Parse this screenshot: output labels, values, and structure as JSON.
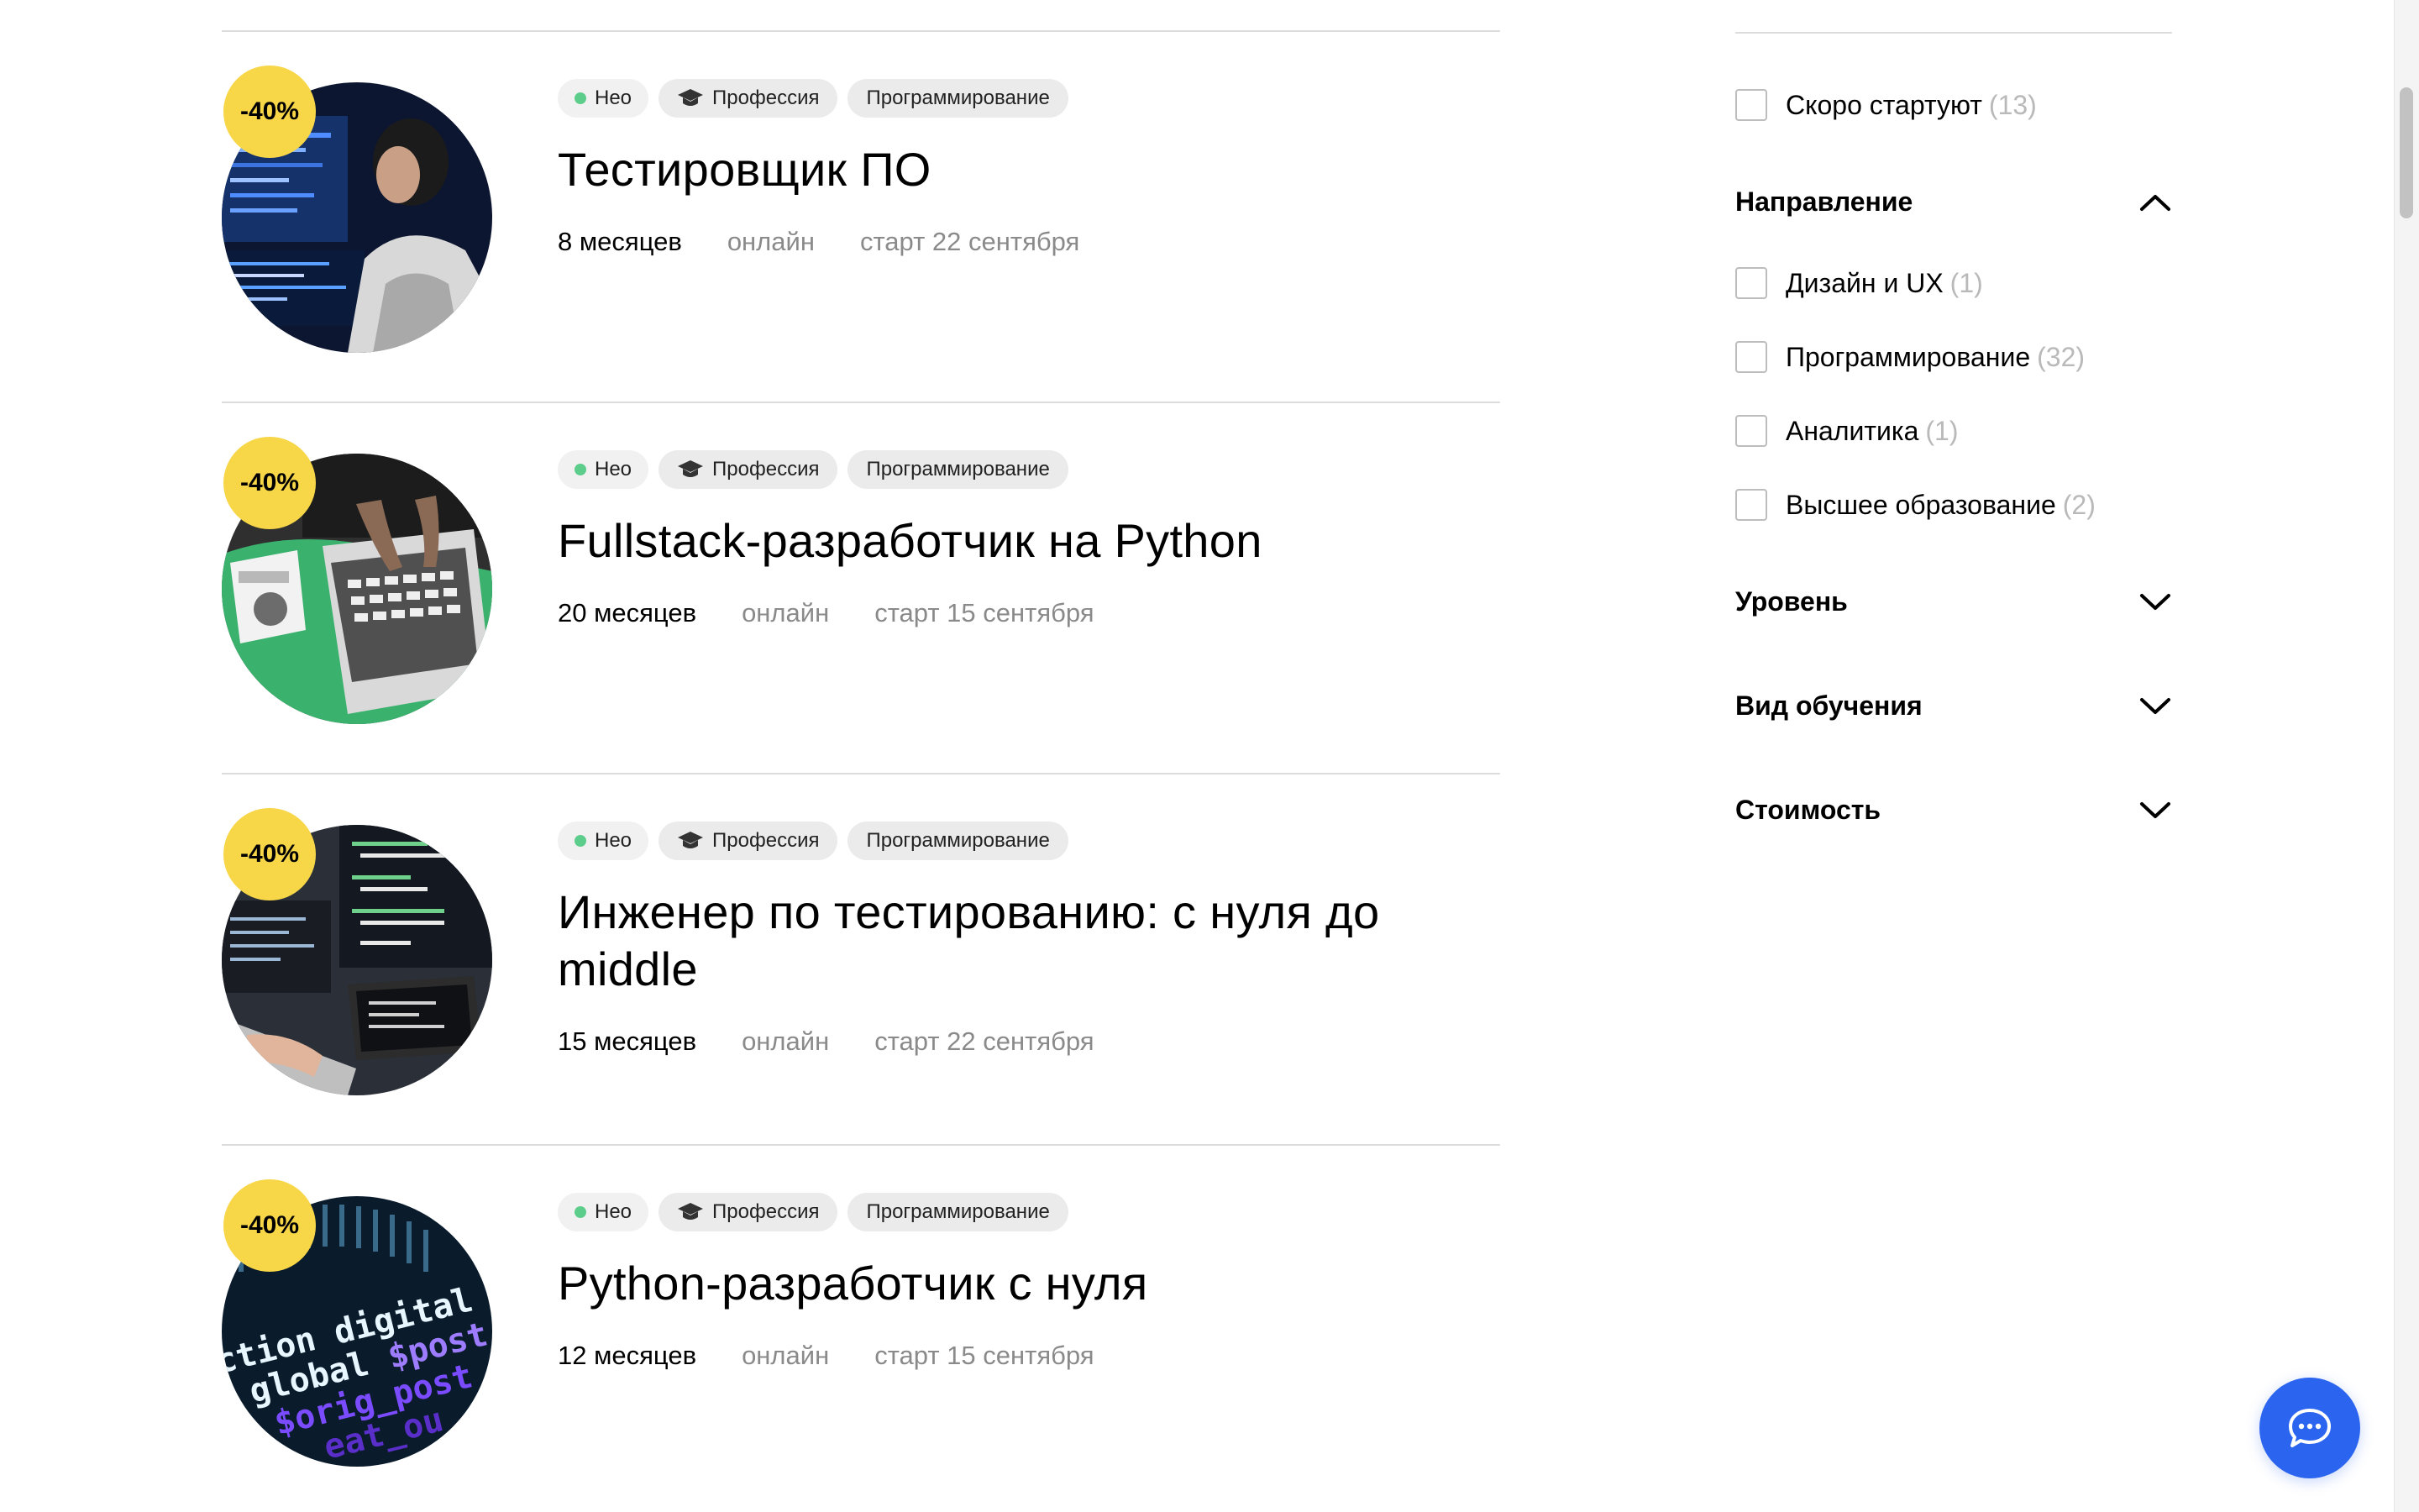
{
  "courses": [
    {
      "discount": "-40%",
      "tags": {
        "neo": "Нео",
        "type": "Профессия",
        "direction": "Программирование"
      },
      "title": "Тестировщик ПО",
      "duration": "8 месяцев",
      "format": "онлайн",
      "start": "старт 22 сентября",
      "image_icon": "person-at-monitors-image"
    },
    {
      "discount": "-40%",
      "tags": {
        "neo": "Нео",
        "type": "Профессия",
        "direction": "Программирование"
      },
      "title": "Fullstack-разработчик на Python",
      "duration": "20 месяцев",
      "format": "онлайн",
      "start": "старт 15 сентября",
      "image_icon": "laptop-python-book-image"
    },
    {
      "discount": "-40%",
      "tags": {
        "neo": "Нео",
        "type": "Профессия",
        "direction": "Программирование"
      },
      "title": "Инженер по тестированию: с нуля до middle",
      "duration": "15 месяцев",
      "format": "онлайн",
      "start": "старт 22 сентября",
      "image_icon": "laptops-code-image"
    },
    {
      "discount": "-40%",
      "tags": {
        "neo": "Нео",
        "type": "Профессия",
        "direction": "Программирование"
      },
      "title": "Python-разработчик с нуля",
      "duration": "12 месяцев",
      "format": "онлайн",
      "start": "старт 15 сентября",
      "image_icon": "code-text-image"
    }
  ],
  "filters": {
    "soon": {
      "label": "Скоро стартуют",
      "count": "(13)"
    },
    "direction": {
      "title": "Направление",
      "expanded": true,
      "options": [
        {
          "label": "Дизайн и UX",
          "count": "(1)"
        },
        {
          "label": "Программирование",
          "count": "(32)"
        },
        {
          "label": "Аналитика",
          "count": "(1)"
        },
        {
          "label": "Высшее образование",
          "count": "(2)"
        }
      ]
    },
    "level": {
      "title": "Уровень",
      "expanded": false
    },
    "study_type": {
      "title": "Вид обучения",
      "expanded": false
    },
    "price": {
      "title": "Стоимость",
      "expanded": false
    }
  },
  "colors": {
    "discount_badge": "#f7d648",
    "neo_dot": "#5dcd8c",
    "chat_button": "#2a64ef",
    "muted_text": "#8a8a8a",
    "count_text": "#b9b9b9"
  },
  "chat": {
    "icon": "chat-bubble-icon"
  }
}
